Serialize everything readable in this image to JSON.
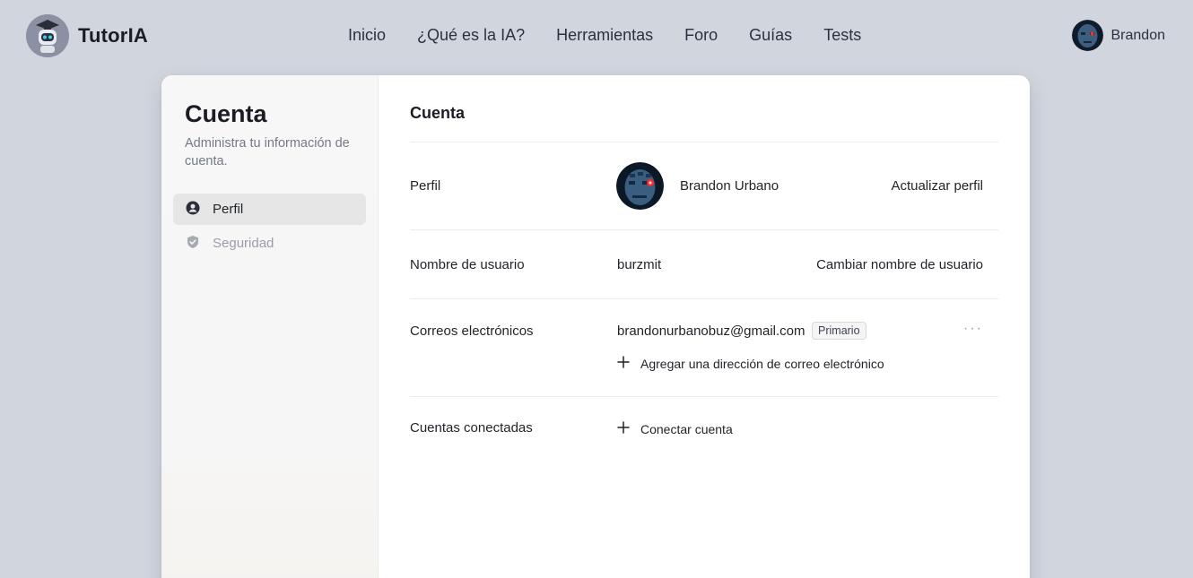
{
  "brand": {
    "name": "TutorIA",
    "logo_icon": "robot-graduate-icon"
  },
  "nav": {
    "items": [
      "Inicio",
      "¿Qué es la IA?",
      "Herramientas",
      "Foro",
      "Guías",
      "Tests"
    ]
  },
  "user": {
    "name": "Brandon",
    "avatar_icon": "robot-face-avatar"
  },
  "sidebar": {
    "title": "Cuenta",
    "subtitle": "Administra tu información de cuenta.",
    "items": [
      {
        "label": "Perfil",
        "icon": "user-circle-icon",
        "active": true
      },
      {
        "label": "Seguridad",
        "icon": "shield-check-icon",
        "active": false
      }
    ]
  },
  "main": {
    "title": "Cuenta",
    "profile": {
      "label": "Perfil",
      "full_name": "Brandon Urbano",
      "action": "Actualizar perfil"
    },
    "username": {
      "label": "Nombre de usuario",
      "value": "burzmit",
      "action": "Cambiar nombre de usuario"
    },
    "emails": {
      "label": "Correos electrónicos",
      "address": "brandonurbanobuz@gmail.com",
      "badge": "Primario",
      "more": "···",
      "add_label": "Agregar una dirección de correo electrónico"
    },
    "connected": {
      "label": "Cuentas conectadas",
      "add_label": "Conectar cuenta"
    }
  },
  "colors": {
    "page_bg": "#d1d5de",
    "card_bg": "#ffffff",
    "sidebar_bg": "#f7f7f7",
    "active_item_bg": "#e6e6e6"
  }
}
